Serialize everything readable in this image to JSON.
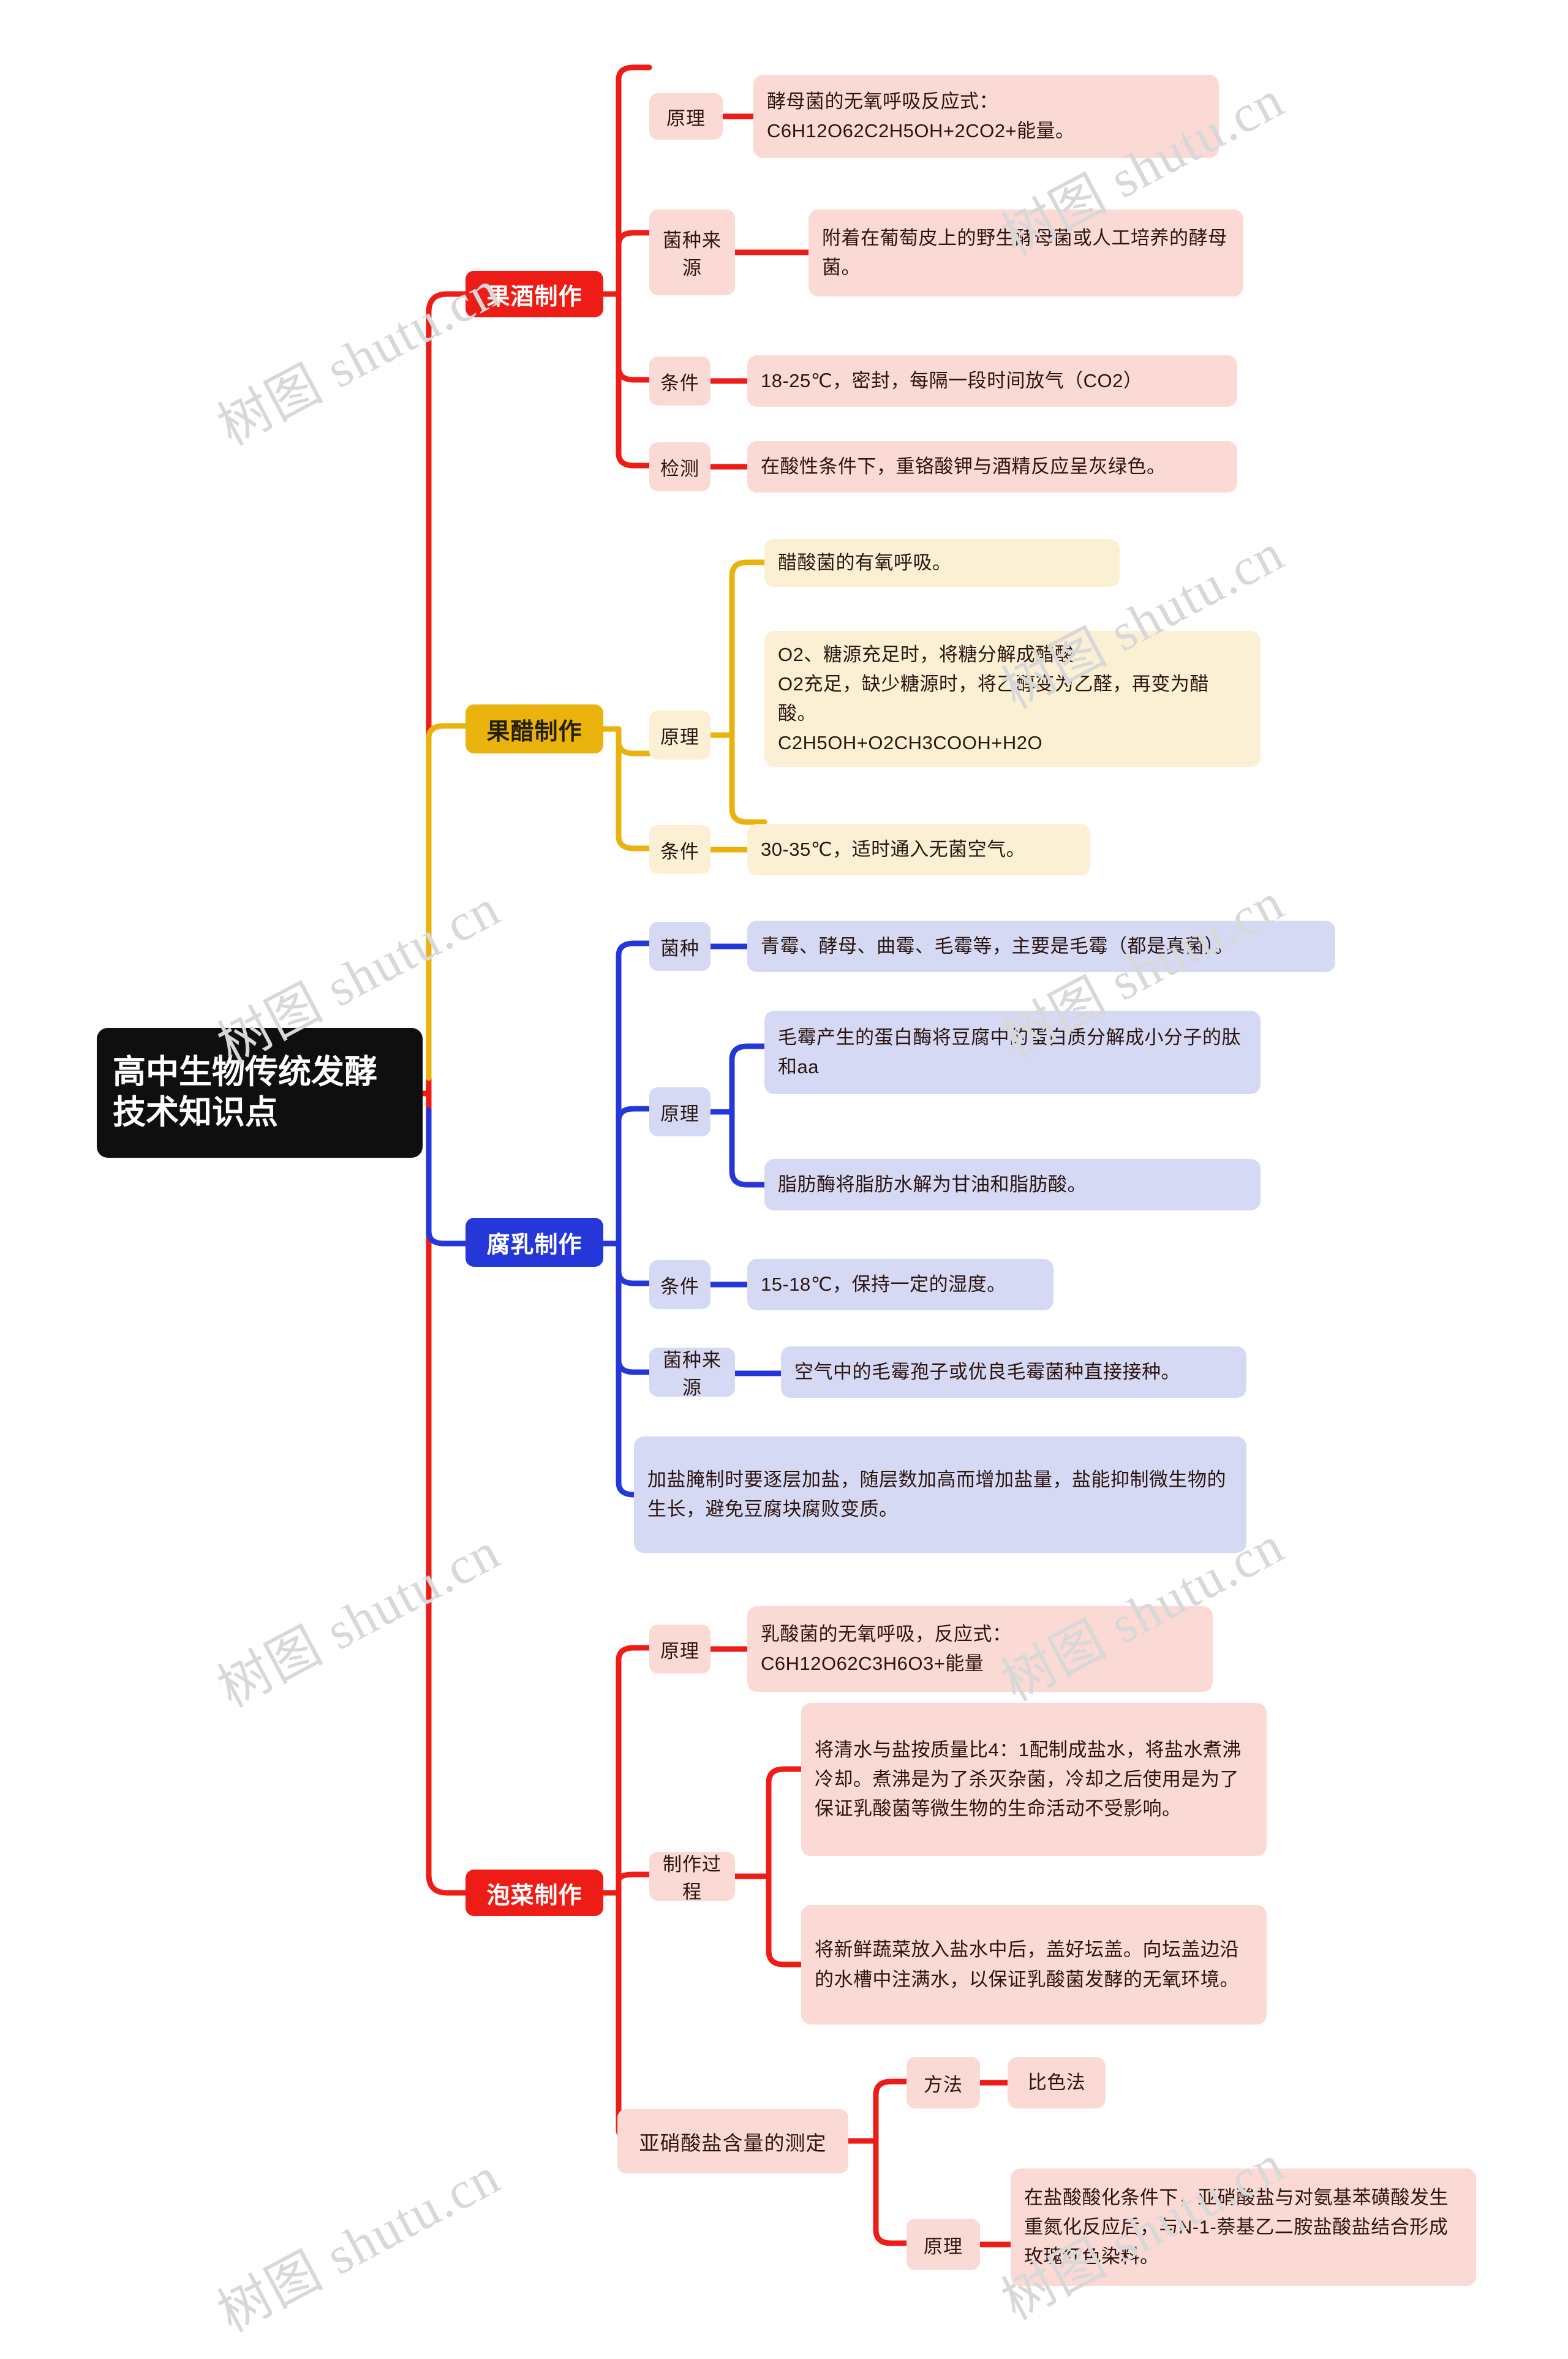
{
  "meta": {
    "watermark_text": "树图 shutu.cn",
    "colors": {
      "root_bg": "#0f0f0f",
      "red": "#ED1C16",
      "gold": "#EAB20C",
      "blue": "#2637D9",
      "tint_red": "#FBD9D4",
      "tint_gold": "#FCF0D4",
      "tint_blue": "#D6D9F4"
    }
  },
  "root": {
    "title": "高中生物传统发酵技术知识点"
  },
  "branches": [
    {
      "id": "fruit-wine",
      "label": "果酒制作",
      "color": "red",
      "children": [
        {
          "label": "原理",
          "leaves": [
            "酵母菌的无氧呼吸反应式：C6H12O62C2H5OH+2CO2+能量。"
          ]
        },
        {
          "label": "菌种来源",
          "leaves": [
            "附着在葡萄皮上的野生酵母菌或人工培养的酵母菌。"
          ]
        },
        {
          "label": "条件",
          "leaves": [
            "18-25℃，密封，每隔一段时间放气（CO2）"
          ]
        },
        {
          "label": "检测",
          "leaves": [
            "在酸性条件下，重铬酸钾与酒精反应呈灰绿色。"
          ]
        }
      ]
    },
    {
      "id": "fruit-vinegar",
      "label": "果醋制作",
      "color": "gold",
      "children": [
        {
          "label": "原理",
          "leaves": [
            "醋酸菌的有氧呼吸。",
            "O2、糖源充足时，将糖分解成醋酸\n O2充足，缺少糖源时，将乙醇变为乙醛，再变为醋酸。\n C2H5OH+O2CH3COOH+H2O"
          ]
        },
        {
          "label": "条件",
          "leaves": [
            "30-35℃，适时通入无菌空气。"
          ]
        }
      ]
    },
    {
      "id": "fermented-tofu",
      "label": "腐乳制作",
      "color": "blue",
      "children": [
        {
          "label": "菌种",
          "leaves": [
            "青霉、酵母、曲霉、毛霉等，主要是毛霉（都是真菌）。"
          ]
        },
        {
          "label": "原理",
          "leaves": [
            "毛霉产生的蛋白酶将豆腐中的蛋白质分解成小分子的肽和aa",
            "脂肪酶将脂肪水解为甘油和脂肪酸。"
          ]
        },
        {
          "label": "条件",
          "leaves": [
            "15-18℃，保持一定的湿度。"
          ]
        },
        {
          "label": "菌种来源",
          "leaves": [
            "空气中的毛霉孢子或优良毛霉菌种直接接种。"
          ]
        },
        {
          "label": "",
          "leaves": [
            "加盐腌制时要逐层加盐，随层数加高而增加盐量，盐能抑制微生物的生长，避免豆腐块腐败变质。"
          ]
        }
      ]
    },
    {
      "id": "pickles",
      "label": "泡菜制作",
      "color": "red",
      "children": [
        {
          "label": "原理",
          "leaves": [
            "乳酸菌的无氧呼吸，反应式：C6H12O62C3H6O3+能量"
          ]
        },
        {
          "label": "制作过程",
          "leaves": [
            "将清水与盐按质量比4：1配制成盐水，将盐水煮沸冷却。煮沸是为了杀灭杂菌，冷却之后使用是为了保证乳酸菌等微生物的生命活动不受影响。",
            "将新鲜蔬菜放入盐水中后，盖好坛盖。向坛盖边沿的水槽中注满水，以保证乳酸菌发酵的无氧环境。"
          ]
        },
        {
          "label": "亚硝酸盐含量的测定",
          "subnodes": [
            {
              "label": "方法",
              "leaves": [
                "比色法"
              ]
            },
            {
              "label": "原理",
              "leaves": [
                "在盐酸酸化条件下，亚硝酸盐与对氨基苯磺酸发生重氮化反应后，与N-1-萘基乙二胺盐酸盐结合形成玫瑰红色染料。"
              ]
            }
          ]
        }
      ]
    }
  ]
}
